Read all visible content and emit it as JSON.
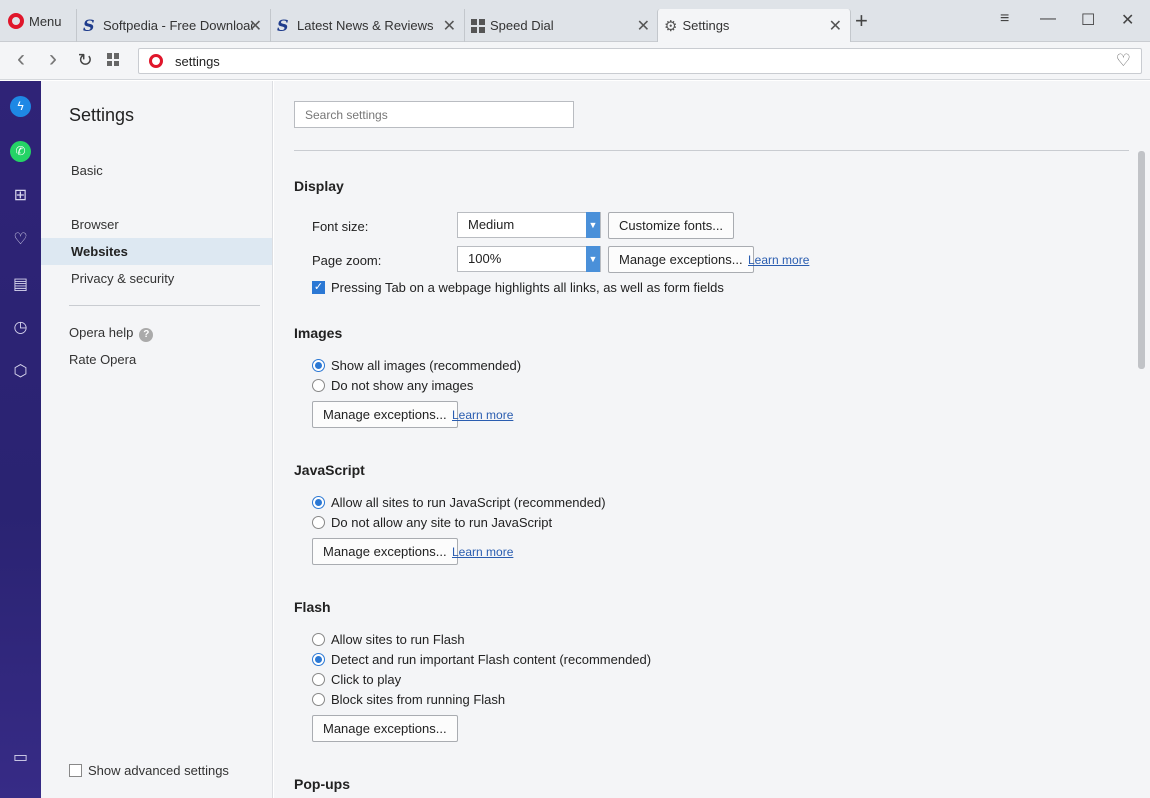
{
  "tabbar": {
    "menu_label": "Menu",
    "tabs": [
      {
        "title": "Softpedia - Free Downloads",
        "icon": "softpedia-icon"
      },
      {
        "title": "Latest News & Reviews by Softpedia",
        "icon": "softpedia-icon"
      },
      {
        "title": "Speed Dial",
        "icon": "grid-icon"
      },
      {
        "title": "Settings",
        "icon": "gear-icon"
      }
    ],
    "new_tab": "+",
    "window_controls": {
      "minimize": "—",
      "maximize": "☐",
      "close": "✕",
      "tab_menu": "≡"
    }
  },
  "addressbar": {
    "back": "‹",
    "forward": "›",
    "reload": "↻",
    "url": "settings"
  },
  "settings_nav": {
    "title": "Settings",
    "items": [
      "Basic",
      "Browser",
      "Websites",
      "Privacy & security"
    ],
    "active": "Websites",
    "help": "Opera help",
    "rate": "Rate Opera",
    "advanced_label": "Show advanced settings"
  },
  "main": {
    "search_placeholder": "Search settings",
    "display": {
      "title": "Display",
      "font_size_label": "Font size:",
      "font_size_value": "Medium",
      "customize_fonts": "Customize fonts...",
      "page_zoom_label": "Page zoom:",
      "page_zoom_value": "100%",
      "manage_exceptions": "Manage exceptions...",
      "learn_more": "Learn more",
      "tab_highlight": "Pressing Tab on a webpage highlights all links, as well as form fields"
    },
    "images": {
      "title": "Images",
      "options": [
        "Show all images (recommended)",
        "Do not show any images"
      ],
      "manage": "Manage exceptions...",
      "learn_more": "Learn more"
    },
    "javascript": {
      "title": "JavaScript",
      "options": [
        "Allow all sites to run JavaScript (recommended)",
        "Do not allow any site to run JavaScript"
      ],
      "manage": "Manage exceptions...",
      "learn_more": "Learn more"
    },
    "flash": {
      "title": "Flash",
      "options": [
        "Allow sites to run Flash",
        "Detect and run important Flash content (recommended)",
        "Click to play",
        "Block sites from running Flash"
      ],
      "manage": "Manage exceptions..."
    },
    "popups": {
      "title": "Pop-ups"
    }
  },
  "colors": {
    "accent": "#2b78d4",
    "sidebar": "#2f2377",
    "opera_red": "#e0162b"
  }
}
